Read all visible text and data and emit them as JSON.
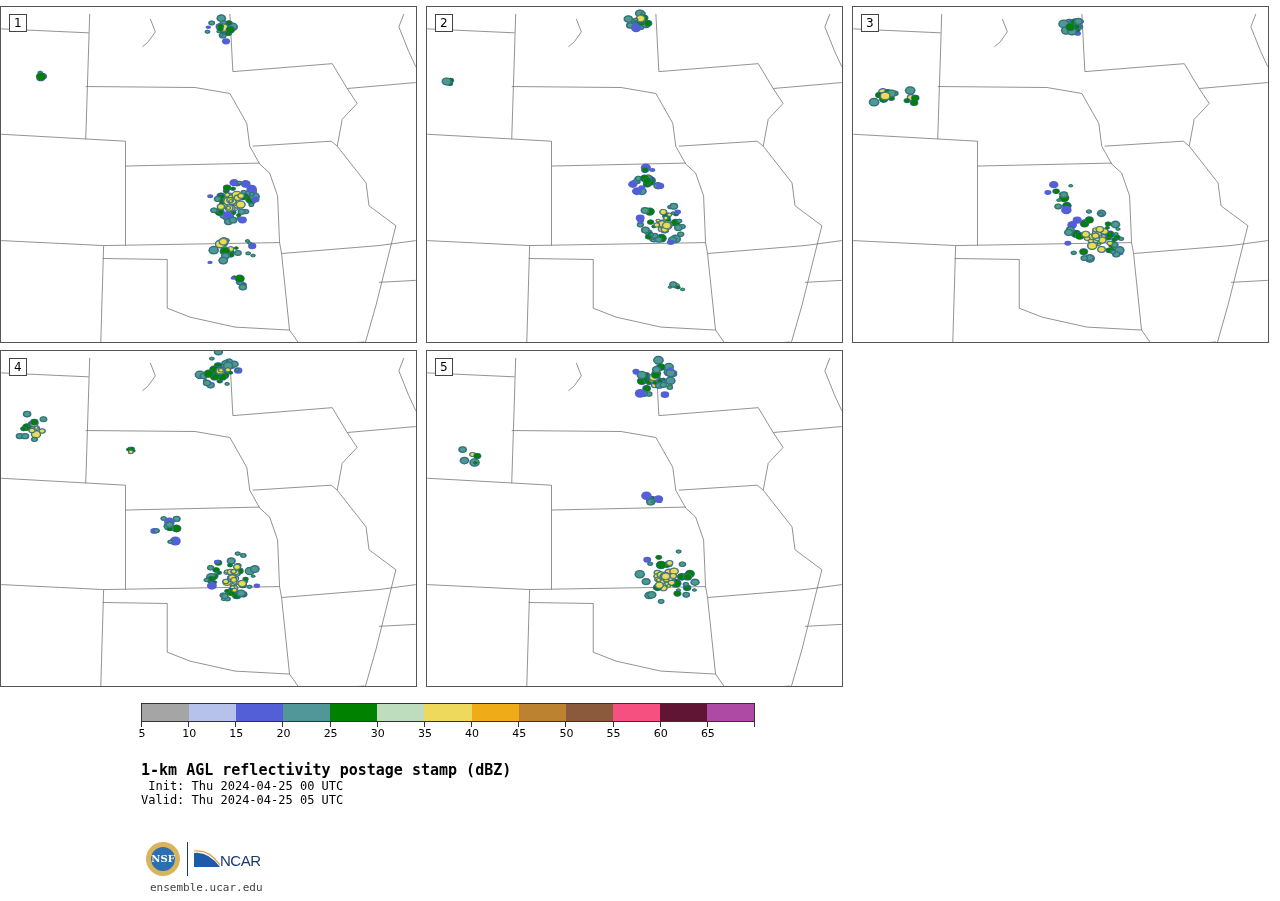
{
  "panels": [
    {
      "label": "1"
    },
    {
      "label": "2"
    },
    {
      "label": "3"
    },
    {
      "label": "4"
    },
    {
      "label": "5"
    }
  ],
  "colorbar": {
    "segments": [
      {
        "color": "#a5a5a5"
      },
      {
        "color": "#b7c2ec"
      },
      {
        "color": "#525fd6"
      },
      {
        "color": "#519699"
      },
      {
        "color": "#008200"
      },
      {
        "color": "#bedcbe"
      },
      {
        "color": "#efd95c"
      },
      {
        "color": "#f0ac18"
      },
      {
        "color": "#bc822f"
      },
      {
        "color": "#8b5a3c"
      },
      {
        "color": "#f55080"
      },
      {
        "color": "#611535"
      },
      {
        "color": "#ae4aa3"
      }
    ],
    "ticks": [
      "5",
      "10",
      "15",
      "20",
      "25",
      "30",
      "35",
      "40",
      "45",
      "50",
      "55",
      "60",
      "65"
    ]
  },
  "title": "1-km AGL reflectivity postage stamp (dBZ)",
  "init": " Init: Thu 2024-04-25 00 UTC",
  "valid": "Valid: Thu 2024-04-25 05 UTC",
  "logo": {
    "seal_text": "NSF",
    "wordmark": "NCAR"
  },
  "footer_url": "ensemble.ucar.edu"
}
